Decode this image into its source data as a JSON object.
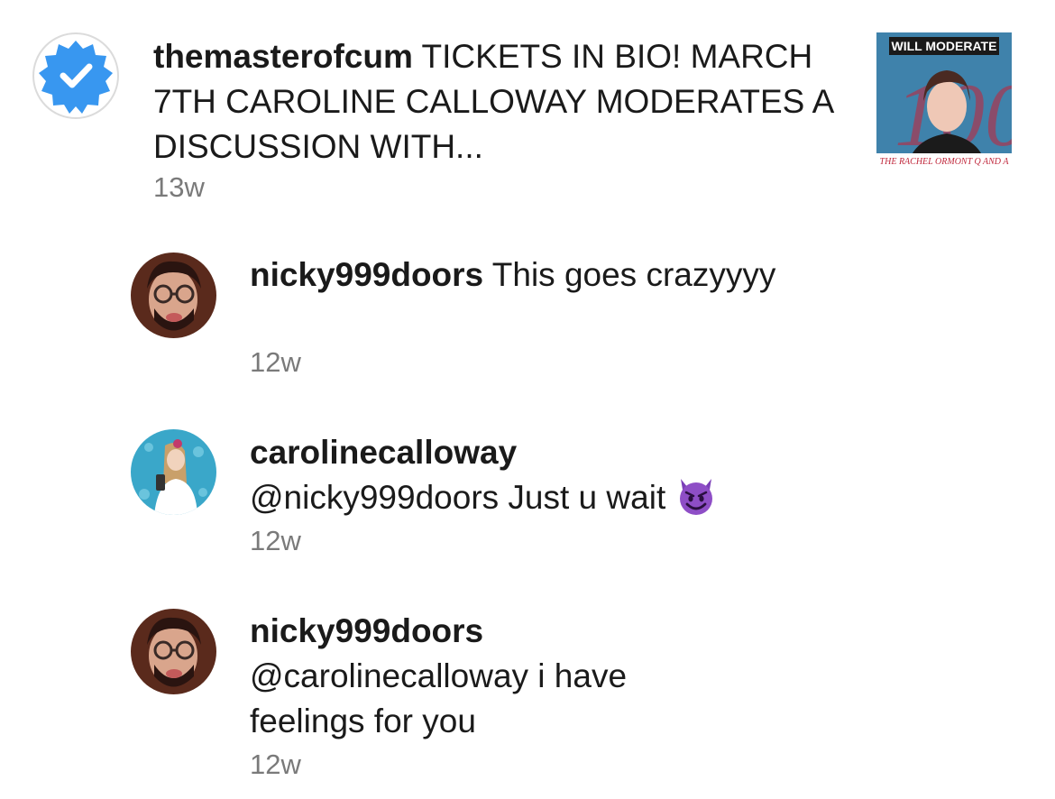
{
  "post": {
    "username": "themasterofcum",
    "caption": "TICKETS IN BIO! MARCH 7TH CAROLINE CALLOWAY MODERATES A DISCUSSION WITH...",
    "time": "13w",
    "thumbnail": {
      "top_text": "WILL MODERATE",
      "bottom_text": "THE RACHEL ORMONT Q AND A",
      "number": "100"
    }
  },
  "comments": [
    {
      "username": "nicky999doors",
      "text": "This goes crazyyyy",
      "time": "12w"
    },
    {
      "username": "carolinecalloway",
      "text": "@nicky999doors Just u wait",
      "emoji": "smiling-imp",
      "time": "12w"
    },
    {
      "username": "nicky999doors",
      "text": "@carolinecalloway i have feelings for you",
      "time": "12w"
    }
  ],
  "colors": {
    "verified_blue": "#3897f0",
    "muted_text": "#7a7a7a",
    "emoji_purple": "#7b3fb8"
  }
}
